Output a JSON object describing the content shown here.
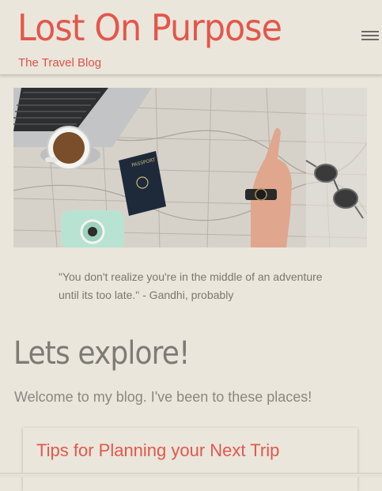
{
  "header": {
    "title": "Lost On Purpose",
    "subtitle": "The Travel Blog",
    "menu_icon": "hamburger-menu-icon"
  },
  "hero": {
    "description_icons": [
      "laptop-icon",
      "coffee-cup-icon",
      "passport-icon",
      "camera-icon",
      "sunglasses-icon",
      "map-icon"
    ],
    "passport_label": "PASSPORT"
  },
  "quote": {
    "text": "\"You don't realize you're in the middle of an adventure until its too late.\" - Gandhi, probably"
  },
  "main": {
    "heading": "Lets explore!",
    "intro": "Welcome to my blog. I've been to these places!"
  },
  "cards": [
    {
      "title": "Tips for Planning your Next Trip"
    }
  ],
  "colors": {
    "background": "#ebe6db",
    "accent": "#e2574c",
    "muted_text": "#8a8781"
  }
}
